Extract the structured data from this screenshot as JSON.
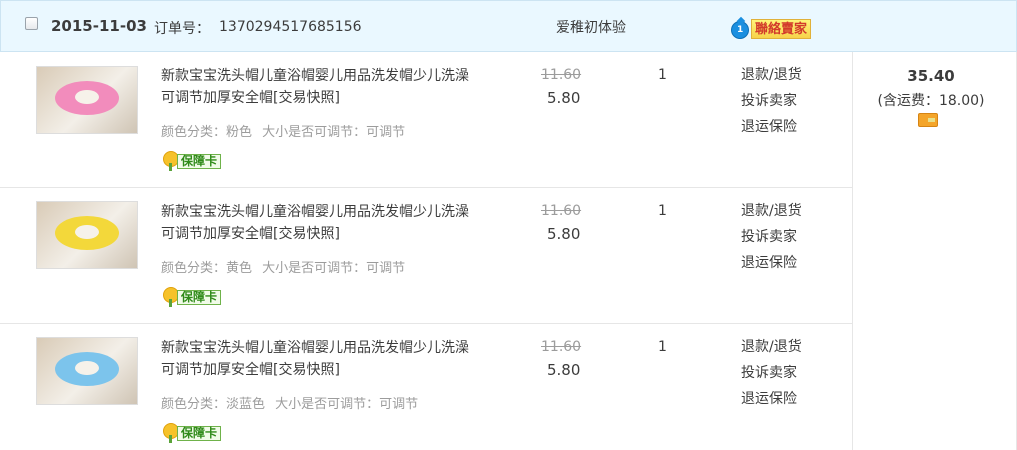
{
  "order": {
    "date": "2015-11-03",
    "order_number_label": "订单号：",
    "order_number": "1370294517685156",
    "shop_name": "爱稚初体验",
    "contact_seller_label": "聯絡賣家",
    "contact_seller_badge": "1",
    "total_amount": "35.40",
    "shipping_note": "(含运费：18.00)",
    "payment_card_icon": "credit-card-icon"
  },
  "items": [
    {
      "title": "新款宝宝洗头帽儿童浴帽婴儿用品洗发帽少儿洗澡可调节加厚安全帽[交易快照]",
      "title_line1": "新款宝宝洗头帽儿童浴帽婴儿用品洗发帽少儿洗澡",
      "title_line2": "可调节加厚安全帽[交易快照]",
      "spec_color": "颜色分类：粉色",
      "spec_size": "大小是否可调节：可调节",
      "guarantee_label": "保障卡",
      "original_price": "11.60",
      "price": "5.80",
      "quantity": "1",
      "actions": [
        "退款/退货",
        "投诉卖家",
        "退运保险"
      ],
      "cap_color": "#f28cbc"
    },
    {
      "title": "新款宝宝洗头帽儿童浴帽婴儿用品洗发帽少儿洗澡可调节加厚安全帽[交易快照]",
      "title_line1": "新款宝宝洗头帽儿童浴帽婴儿用品洗发帽少儿洗澡",
      "title_line2": "可调节加厚安全帽[交易快照]",
      "spec_color": "颜色分类：黄色",
      "spec_size": "大小是否可调节：可调节",
      "guarantee_label": "保障卡",
      "original_price": "11.60",
      "price": "5.80",
      "quantity": "1",
      "actions": [
        "退款/退货",
        "投诉卖家",
        "退运保险"
      ],
      "cap_color": "#f3d83a"
    },
    {
      "title": "新款宝宝洗头帽儿童浴帽婴儿用品洗发帽少儿洗澡可调节加厚安全帽[交易快照]",
      "title_line1": "新款宝宝洗头帽儿童浴帽婴儿用品洗发帽少儿洗澡",
      "title_line2": "可调节加厚安全帽[交易快照]",
      "spec_color": "颜色分类：淡蓝色",
      "spec_size": "大小是否可调节：可调节",
      "guarantee_label": "保障卡",
      "original_price": "11.60",
      "price": "5.80",
      "quantity": "1",
      "actions": [
        "退款/退货",
        "投诉卖家",
        "退运保险"
      ],
      "cap_color": "#7cc4ec"
    }
  ],
  "colors": {
    "header_bg": "#eaf8ff",
    "border": "#e6e6e6",
    "muted_text": "#9c9c9c",
    "main_text": "#3c3c3c"
  }
}
